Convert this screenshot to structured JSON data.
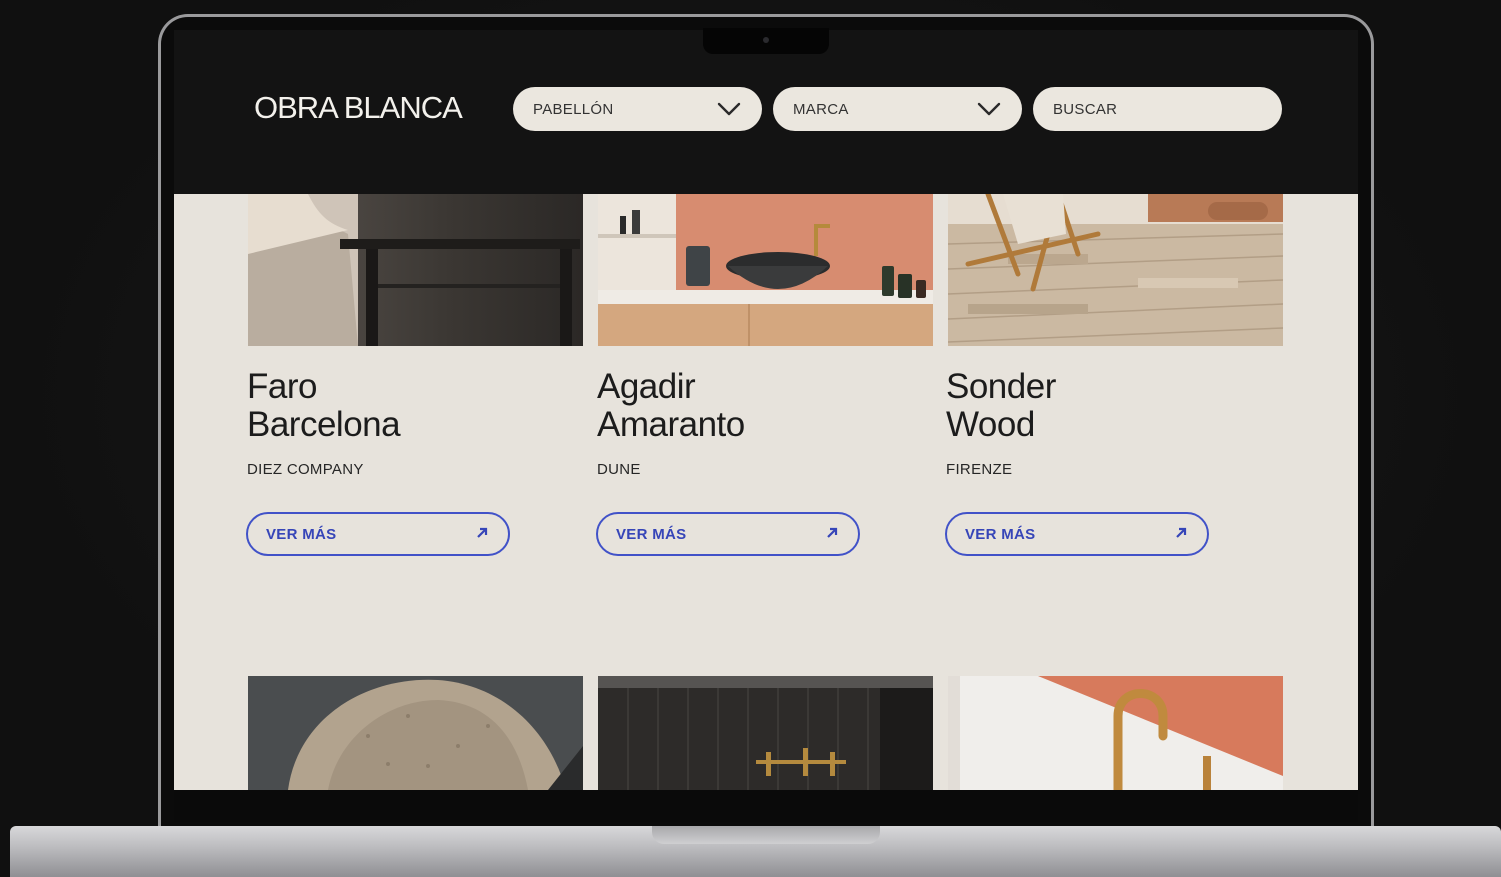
{
  "header": {
    "logo": "OBRA BLANCA",
    "filters": [
      {
        "label": "PABELLÓN",
        "has_dropdown": true
      },
      {
        "label": "MARCA",
        "has_dropdown": true
      }
    ],
    "search": {
      "placeholder": "BUSCAR"
    }
  },
  "cards": [
    {
      "title_line1": "Faro",
      "title_line2": "Barcelona",
      "brand": "DIEZ COMPANY",
      "button": "VER MÁS",
      "image": "bedroom-photo"
    },
    {
      "title_line1": "Agadir",
      "title_line2": "Amaranto",
      "brand": "DUNE",
      "button": "VER MÁS",
      "image": "bathroom-sink-photo"
    },
    {
      "title_line1": "Sonder",
      "title_line2": "Wood",
      "brand": "FIRENZE",
      "button": "VER MÁS",
      "image": "wood-floor-photo"
    }
  ],
  "next_row_images": [
    "stone-photo",
    "dark-wall-faucet-photo",
    "gold-faucet-photo"
  ],
  "colors": {
    "accent_blue": "#3645b8",
    "background": "#e7e3dc",
    "header": "#131313",
    "filter_pill": "#ebe7df"
  }
}
